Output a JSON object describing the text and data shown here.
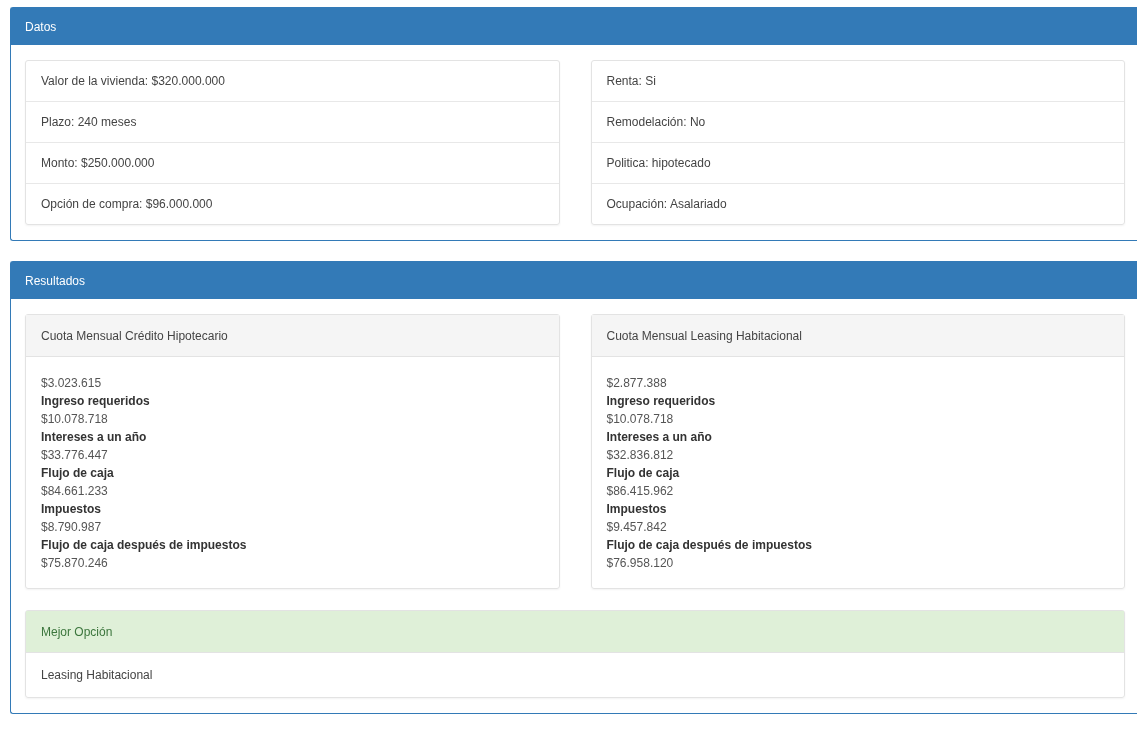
{
  "datos": {
    "title": "Datos",
    "left": [
      "Valor de la vivienda: $320.000.000",
      "Plazo: 240 meses",
      "Monto: $250.000.000",
      "Opción de compra: $96.000.000"
    ],
    "right": [
      "Renta: Si",
      "Remodelación: No",
      "Politica: hipotecado",
      "Ocupación: Asalariado"
    ]
  },
  "resultados": {
    "title": "Resultados",
    "cards": [
      {
        "title": "Cuota Mensual Crédito Hipotecario",
        "lines": [
          {
            "kind": "value",
            "text": "$3.023.615"
          },
          {
            "kind": "label",
            "text": "Ingreso requeridos"
          },
          {
            "kind": "value",
            "text": "$10.078.718"
          },
          {
            "kind": "label",
            "text": "Intereses a un año"
          },
          {
            "kind": "value",
            "text": "$33.776.447"
          },
          {
            "kind": "label",
            "text": "Flujo de caja"
          },
          {
            "kind": "value",
            "text": "$84.661.233"
          },
          {
            "kind": "label",
            "text": "Impuestos"
          },
          {
            "kind": "value",
            "text": "$8.790.987"
          },
          {
            "kind": "label",
            "text": "Flujo de caja después de impuestos"
          },
          {
            "kind": "value",
            "text": "$75.870.246"
          }
        ]
      },
      {
        "title": "Cuota Mensual Leasing Habitacional",
        "lines": [
          {
            "kind": "value",
            "text": "$2.877.388"
          },
          {
            "kind": "label",
            "text": "Ingreso requeridos"
          },
          {
            "kind": "value",
            "text": "$10.078.718"
          },
          {
            "kind": "label",
            "text": "Intereses a un año"
          },
          {
            "kind": "value",
            "text": "$32.836.812"
          },
          {
            "kind": "label",
            "text": "Flujo de caja"
          },
          {
            "kind": "value",
            "text": "$86.415.962"
          },
          {
            "kind": "label",
            "text": "Impuestos"
          },
          {
            "kind": "value",
            "text": "$9.457.842"
          },
          {
            "kind": "label",
            "text": "Flujo de caja después de impuestos"
          },
          {
            "kind": "value",
            "text": "$76.958.120"
          }
        ]
      }
    ],
    "best": {
      "title": "Mejor Opción",
      "text": "Leasing Habitacional"
    }
  }
}
